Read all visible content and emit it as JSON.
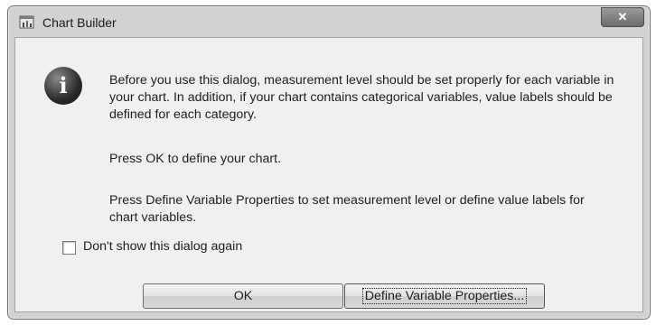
{
  "window": {
    "title": "Chart Builder",
    "close_glyph": "✕"
  },
  "icons": {
    "app": "chart-builder-icon",
    "info": "information-icon",
    "info_glyph": "i"
  },
  "message": {
    "paragraph1": "Before you use this dialog, measurement level should be set properly for each variable in your chart. In addition, if your chart contains categorical variables, value labels should be defined for each category.",
    "paragraph2": "Press OK to define your chart.",
    "paragraph3": "Press Define Variable Properties to set measurement level or define value labels for chart variables."
  },
  "checkbox": {
    "label": "Don't show this dialog again",
    "checked": false
  },
  "buttons": {
    "ok": "OK",
    "define": "Define Variable Properties..."
  }
}
